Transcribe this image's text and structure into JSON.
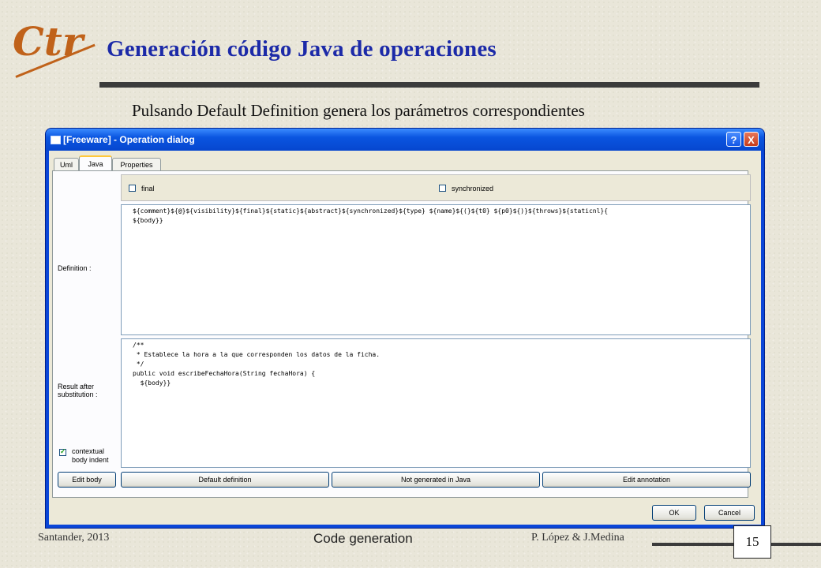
{
  "slide": {
    "logo_text": "Ctr",
    "title": "Generación código Java de operaciones",
    "subtitle": "Pulsando Default Definition genera los parámetros correspondientes"
  },
  "dialog": {
    "title": "[Freeware] - Operation dialog",
    "help_glyph": "?",
    "close_glyph": "X",
    "tabs": [
      {
        "label": "Uml",
        "active": false
      },
      {
        "label": "Java",
        "active": true
      },
      {
        "label": "Properties",
        "active": false
      }
    ],
    "checkboxes": {
      "final": {
        "label": "final",
        "checked": false
      },
      "synchronized": {
        "label": "synchronized",
        "checked": false
      }
    },
    "definition_label": "Definition :",
    "definition_lines": [
      "${comment}${@}${visibility}${final}${static}${abstract}${synchronized}${type} ${name}${(}${t0} ${p0}${)}${throws}${staticnl}{",
      "${body}}"
    ],
    "result_label_1": "Result after",
    "result_label_2": "substitution :",
    "result_lines": [
      "/**",
      " * Establece la hora a la que corresponden los datos de la ficha.",
      " */",
      "public void escribeFechaHora(String fechaHora) {",
      "  ${body}}"
    ],
    "contextual": {
      "label_1": "contextual",
      "label_2": "body indent",
      "checked": true
    },
    "buttons": {
      "edit_body": "Edit body",
      "default_definition": "Default definition",
      "not_generated": "Not generated in Java",
      "edit_annotation": "Edit annotation",
      "ok": "OK",
      "cancel": "Cancel"
    }
  },
  "footer": {
    "left": "Santander, 2013",
    "center": "Code generation",
    "right": "P. López & J.Medina",
    "page": "15"
  },
  "colors": {
    "title": "#1c2aa8",
    "logo": "#c0621a",
    "titlebar": "#0a55e0",
    "window_bg": "#ece9d8"
  }
}
